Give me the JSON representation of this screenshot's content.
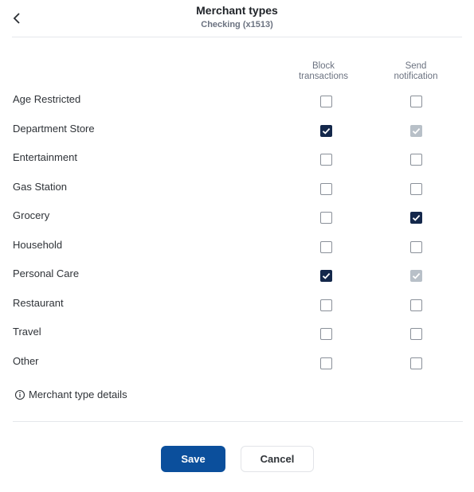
{
  "header": {
    "title": "Merchant types",
    "subtitle": "Checking (x1513)",
    "back_icon": "chevron-left-icon"
  },
  "columns": {
    "block": "Block\ntransactions",
    "notify": "Send\nnotification"
  },
  "rows": [
    {
      "label": "Age Restricted",
      "block": "unchecked",
      "notify": "unchecked"
    },
    {
      "label": "Department Store",
      "block": "checked",
      "notify": "checked-disabled"
    },
    {
      "label": "Entertainment",
      "block": "unchecked",
      "notify": "unchecked"
    },
    {
      "label": "Gas Station",
      "block": "unchecked",
      "notify": "unchecked"
    },
    {
      "label": "Grocery",
      "block": "unchecked",
      "notify": "checked"
    },
    {
      "label": "Household",
      "block": "unchecked",
      "notify": "unchecked"
    },
    {
      "label": "Personal Care",
      "block": "checked",
      "notify": "checked-disabled"
    },
    {
      "label": "Restaurant",
      "block": "unchecked",
      "notify": "unchecked"
    },
    {
      "label": "Travel",
      "block": "unchecked",
      "notify": "unchecked"
    },
    {
      "label": "Other",
      "block": "unchecked",
      "notify": "unchecked"
    }
  ],
  "details_link": {
    "label": "Merchant type details",
    "icon": "info-icon"
  },
  "actions": {
    "save": "Save",
    "cancel": "Cancel"
  },
  "colors": {
    "primary": "#0b4f9c",
    "checked": "#14284b",
    "disabled": "#b8c0c8"
  }
}
